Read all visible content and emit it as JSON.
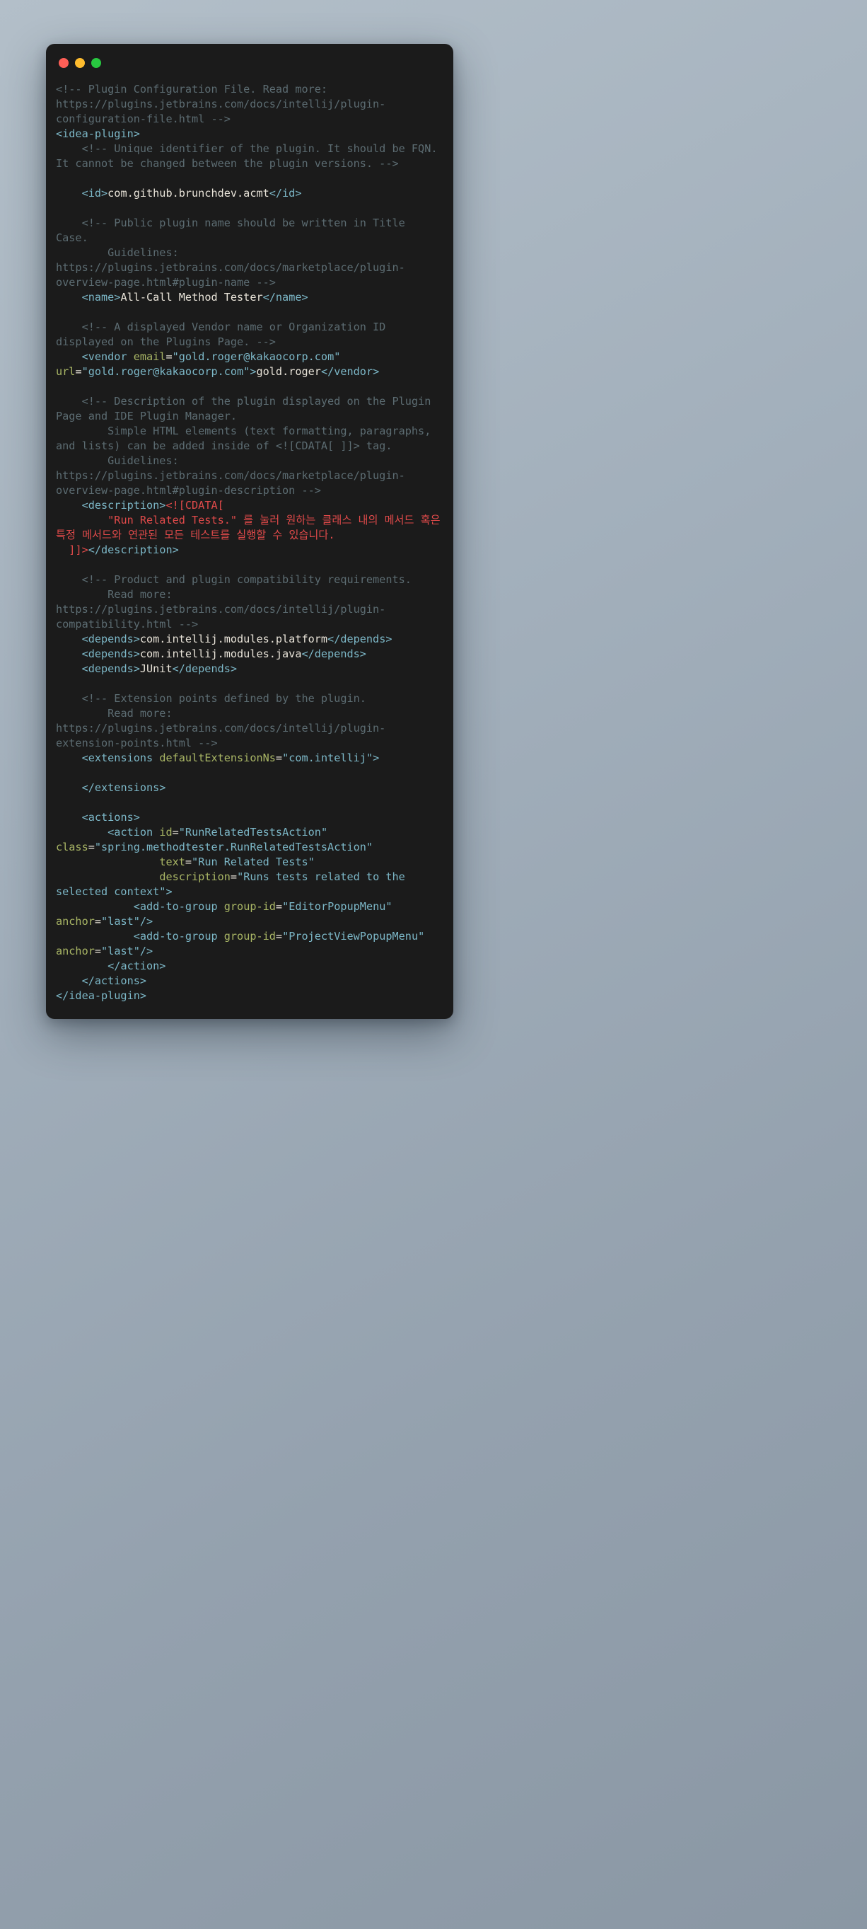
{
  "window": {
    "traffic_lights": [
      {
        "name": "close-button",
        "color": "#ff5f57",
        "label": "close"
      },
      {
        "name": "minimize-button",
        "color": "#febc2e",
        "label": "minimize"
      },
      {
        "name": "maximize-button",
        "color": "#28c840",
        "label": "maximize"
      }
    ]
  },
  "theme": {
    "background_start": "#b3bfc9",
    "background_end": "#8a97a4",
    "window_background": "#1b1b1b",
    "comment_color": "#5c6c72",
    "tag_color": "#7cb7c7",
    "attribute_name_color": "#a9b665",
    "attribute_value_color": "#7cb7c7",
    "text_color": "#e8e3d8",
    "cdata_color": "#e04a4a"
  },
  "code": {
    "language": "xml",
    "filename": "plugin.xml",
    "lines": [
      {
        "id": "l1",
        "segments": [
          {
            "cls": "cmt",
            "t": "<!-- Plugin Configuration File. Read more: https://plugins.jetbrains.com/docs/intellij/plugin-configuration-file.html -->"
          }
        ]
      },
      {
        "id": "l2",
        "segments": [
          {
            "cls": "tag",
            "t": "<idea-plugin>"
          }
        ]
      },
      {
        "id": "l3",
        "segments": [
          {
            "cls": "cmt",
            "t": "    <!-- Unique identifier of the plugin. It should be FQN. It cannot be changed between the plugin versions. -->"
          }
        ]
      },
      {
        "id": "l4",
        "segments": [
          {
            "cls": "blank",
            "t": ""
          }
        ]
      },
      {
        "id": "l5",
        "segments": [
          {
            "cls": "plain",
            "t": "    "
          },
          {
            "cls": "tag",
            "t": "<id>"
          },
          {
            "cls": "txt",
            "t": "com.github.brunchdev.acmt"
          },
          {
            "cls": "tag",
            "t": "</id>"
          }
        ]
      },
      {
        "id": "l6",
        "segments": [
          {
            "cls": "blank",
            "t": ""
          }
        ]
      },
      {
        "id": "l7",
        "segments": [
          {
            "cls": "cmt",
            "t": "    <!-- Public plugin name should be written in Title Case."
          }
        ]
      },
      {
        "id": "l8",
        "segments": [
          {
            "cls": "cmt",
            "t": "        Guidelines: https://plugins.jetbrains.com/docs/marketplace/plugin-overview-page.html#plugin-name -->"
          }
        ]
      },
      {
        "id": "l9",
        "segments": [
          {
            "cls": "plain",
            "t": "    "
          },
          {
            "cls": "tag",
            "t": "<name>"
          },
          {
            "cls": "txt",
            "t": "All-Call Method Tester"
          },
          {
            "cls": "tag",
            "t": "</name>"
          }
        ]
      },
      {
        "id": "l10",
        "segments": [
          {
            "cls": "blank",
            "t": ""
          }
        ]
      },
      {
        "id": "l11",
        "segments": [
          {
            "cls": "cmt",
            "t": "    <!-- A displayed Vendor name or Organization ID displayed on the Plugins Page. -->"
          }
        ]
      },
      {
        "id": "l12",
        "segments": [
          {
            "cls": "plain",
            "t": "    "
          },
          {
            "cls": "tag",
            "t": "<vendor"
          },
          {
            "cls": "plain",
            "t": " "
          },
          {
            "cls": "attr",
            "t": "email"
          },
          {
            "cls": "eq",
            "t": "="
          },
          {
            "cls": "val",
            "t": "\"gold.roger@kakaocorp.com\""
          },
          {
            "cls": "plain",
            "t": " "
          },
          {
            "cls": "attr",
            "t": "url"
          },
          {
            "cls": "eq",
            "t": "="
          },
          {
            "cls": "val",
            "t": "\"gold.roger@kakaocorp.com\""
          },
          {
            "cls": "tag",
            "t": ">"
          },
          {
            "cls": "txt",
            "t": "gold.roger"
          },
          {
            "cls": "tag",
            "t": "</vendor>"
          }
        ]
      },
      {
        "id": "l13",
        "segments": [
          {
            "cls": "blank",
            "t": ""
          }
        ]
      },
      {
        "id": "l14",
        "segments": [
          {
            "cls": "cmt",
            "t": "    <!-- Description of the plugin displayed on the Plugin Page and IDE Plugin Manager."
          }
        ]
      },
      {
        "id": "l15",
        "segments": [
          {
            "cls": "cmt",
            "t": "        Simple HTML elements (text formatting, paragraphs, and lists) can be added inside of <![CDATA[ ]]> tag."
          }
        ]
      },
      {
        "id": "l16",
        "segments": [
          {
            "cls": "cmt",
            "t": "        Guidelines: https://plugins.jetbrains.com/docs/marketplace/plugin-overview-page.html#plugin-description -->"
          }
        ]
      },
      {
        "id": "l17",
        "segments": [
          {
            "cls": "plain",
            "t": "    "
          },
          {
            "cls": "tag",
            "t": "<description>"
          },
          {
            "cls": "cdata",
            "t": "<![CDATA["
          }
        ]
      },
      {
        "id": "l18",
        "segments": [
          {
            "cls": "cdata",
            "t": "        \"Run Related Tests.\" 를 눌러 원하는 클래스 내의 메서드 혹은 특정 메서드와 연관된 모든 테스트를 실행할 수 있습니다."
          }
        ]
      },
      {
        "id": "l19",
        "segments": [
          {
            "cls": "plain",
            "t": "  "
          },
          {
            "cls": "cdata",
            "t": "]]>"
          },
          {
            "cls": "tag",
            "t": "</description>"
          }
        ]
      },
      {
        "id": "l20",
        "segments": [
          {
            "cls": "blank",
            "t": ""
          }
        ]
      },
      {
        "id": "l21",
        "segments": [
          {
            "cls": "cmt",
            "t": "    <!-- Product and plugin compatibility requirements."
          }
        ]
      },
      {
        "id": "l22",
        "segments": [
          {
            "cls": "cmt",
            "t": "        Read more: https://plugins.jetbrains.com/docs/intellij/plugin-compatibility.html -->"
          }
        ]
      },
      {
        "id": "l23",
        "segments": [
          {
            "cls": "plain",
            "t": "    "
          },
          {
            "cls": "tag",
            "t": "<depends>"
          },
          {
            "cls": "txt",
            "t": "com.intellij.modules.platform"
          },
          {
            "cls": "tag",
            "t": "</depends>"
          }
        ]
      },
      {
        "id": "l24",
        "segments": [
          {
            "cls": "plain",
            "t": "    "
          },
          {
            "cls": "tag",
            "t": "<depends>"
          },
          {
            "cls": "txt",
            "t": "com.intellij.modules.java"
          },
          {
            "cls": "tag",
            "t": "</depends>"
          }
        ]
      },
      {
        "id": "l25",
        "segments": [
          {
            "cls": "plain",
            "t": "    "
          },
          {
            "cls": "tag",
            "t": "<depends>"
          },
          {
            "cls": "txt",
            "t": "JUnit"
          },
          {
            "cls": "tag",
            "t": "</depends>"
          }
        ]
      },
      {
        "id": "l26",
        "segments": [
          {
            "cls": "blank",
            "t": ""
          }
        ]
      },
      {
        "id": "l27",
        "segments": [
          {
            "cls": "cmt",
            "t": "    <!-- Extension points defined by the plugin."
          }
        ]
      },
      {
        "id": "l28",
        "segments": [
          {
            "cls": "cmt",
            "t": "        Read more: https://plugins.jetbrains.com/docs/intellij/plugin-extension-points.html -->"
          }
        ]
      },
      {
        "id": "l29",
        "segments": [
          {
            "cls": "plain",
            "t": "    "
          },
          {
            "cls": "tag",
            "t": "<extensions"
          },
          {
            "cls": "plain",
            "t": " "
          },
          {
            "cls": "attr",
            "t": "defaultExtensionNs"
          },
          {
            "cls": "eq",
            "t": "="
          },
          {
            "cls": "val",
            "t": "\"com.intellij\""
          },
          {
            "cls": "tag",
            "t": ">"
          }
        ]
      },
      {
        "id": "l30",
        "segments": [
          {
            "cls": "blank",
            "t": ""
          }
        ]
      },
      {
        "id": "l31",
        "segments": [
          {
            "cls": "plain",
            "t": "    "
          },
          {
            "cls": "tag",
            "t": "</extensions>"
          }
        ]
      },
      {
        "id": "l32",
        "segments": [
          {
            "cls": "blank",
            "t": ""
          }
        ]
      },
      {
        "id": "l33",
        "segments": [
          {
            "cls": "plain",
            "t": "    "
          },
          {
            "cls": "tag",
            "t": "<actions>"
          }
        ]
      },
      {
        "id": "l34",
        "segments": [
          {
            "cls": "plain",
            "t": "        "
          },
          {
            "cls": "tag",
            "t": "<action"
          },
          {
            "cls": "plain",
            "t": " "
          },
          {
            "cls": "attr",
            "t": "id"
          },
          {
            "cls": "eq",
            "t": "="
          },
          {
            "cls": "val",
            "t": "\"RunRelatedTestsAction\""
          },
          {
            "cls": "plain",
            "t": " "
          },
          {
            "cls": "attr",
            "t": "class"
          },
          {
            "cls": "eq",
            "t": "="
          },
          {
            "cls": "val",
            "t": "\"spring.methodtester.RunRelatedTestsAction\""
          }
        ]
      },
      {
        "id": "l35",
        "segments": [
          {
            "cls": "plain",
            "t": "                "
          },
          {
            "cls": "attr",
            "t": "text"
          },
          {
            "cls": "eq",
            "t": "="
          },
          {
            "cls": "val",
            "t": "\"Run Related Tests\""
          }
        ]
      },
      {
        "id": "l36",
        "segments": [
          {
            "cls": "plain",
            "t": "                "
          },
          {
            "cls": "attr",
            "t": "description"
          },
          {
            "cls": "eq",
            "t": "="
          },
          {
            "cls": "val",
            "t": "\"Runs tests related to the selected context\""
          },
          {
            "cls": "tag",
            "t": ">"
          }
        ]
      },
      {
        "id": "l37",
        "segments": [
          {
            "cls": "plain",
            "t": "            "
          },
          {
            "cls": "tag",
            "t": "<add-to-group"
          },
          {
            "cls": "plain",
            "t": " "
          },
          {
            "cls": "attr",
            "t": "group-id"
          },
          {
            "cls": "eq",
            "t": "="
          },
          {
            "cls": "val",
            "t": "\"EditorPopupMenu\""
          },
          {
            "cls": "plain",
            "t": " "
          },
          {
            "cls": "attr",
            "t": "anchor"
          },
          {
            "cls": "eq",
            "t": "="
          },
          {
            "cls": "val",
            "t": "\"last\""
          },
          {
            "cls": "tag",
            "t": "/>"
          }
        ]
      },
      {
        "id": "l38",
        "segments": [
          {
            "cls": "plain",
            "t": "            "
          },
          {
            "cls": "tag",
            "t": "<add-to-group"
          },
          {
            "cls": "plain",
            "t": " "
          },
          {
            "cls": "attr",
            "t": "group-id"
          },
          {
            "cls": "eq",
            "t": "="
          },
          {
            "cls": "val",
            "t": "\"ProjectViewPopupMenu\""
          },
          {
            "cls": "plain",
            "t": " "
          },
          {
            "cls": "attr",
            "t": "anchor"
          },
          {
            "cls": "eq",
            "t": "="
          },
          {
            "cls": "val",
            "t": "\"last\""
          },
          {
            "cls": "tag",
            "t": "/>"
          }
        ]
      },
      {
        "id": "l39",
        "segments": [
          {
            "cls": "plain",
            "t": "        "
          },
          {
            "cls": "tag",
            "t": "</action>"
          }
        ]
      },
      {
        "id": "l40",
        "segments": [
          {
            "cls": "plain",
            "t": "    "
          },
          {
            "cls": "tag",
            "t": "</actions>"
          }
        ]
      },
      {
        "id": "l41",
        "segments": [
          {
            "cls": "tag",
            "t": "</idea-plugin>"
          }
        ]
      }
    ]
  }
}
